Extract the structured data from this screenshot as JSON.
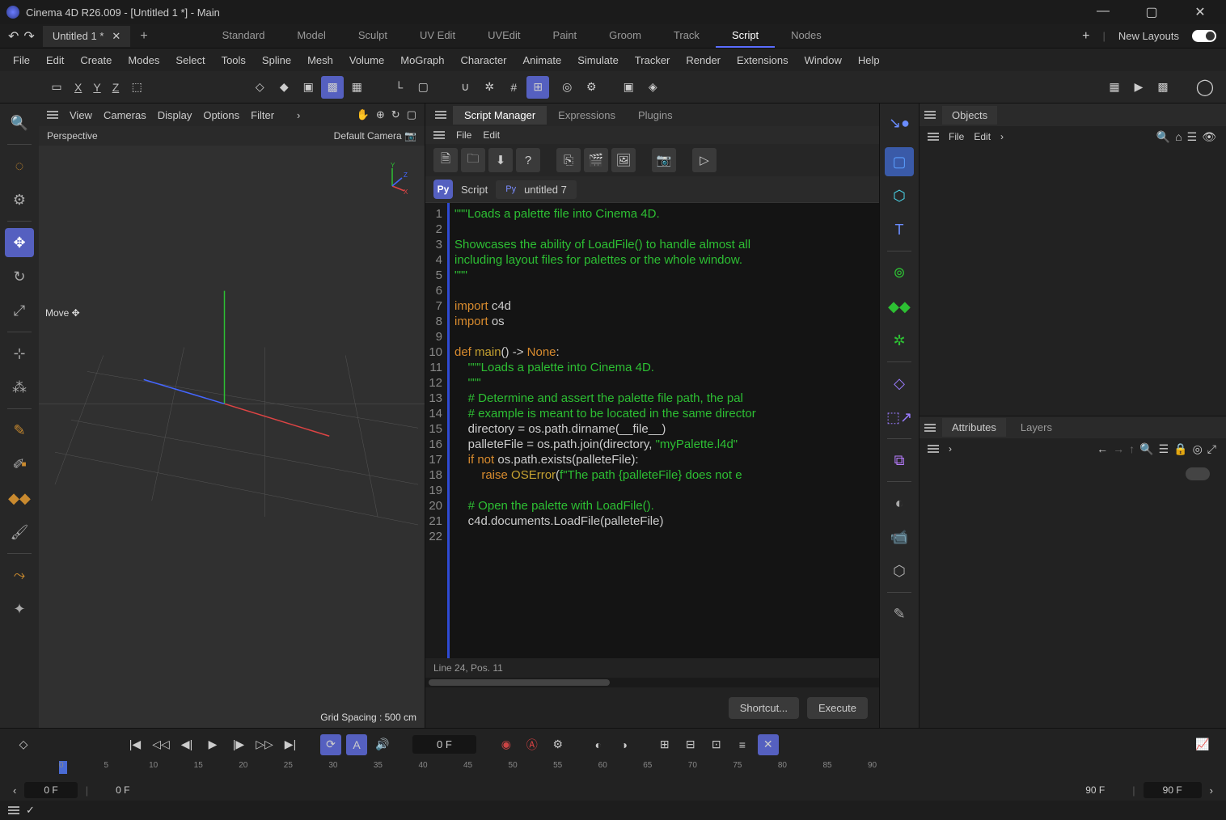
{
  "title": "Cinema 4D R26.009 - [Untitled 1 *] - Main",
  "file_tab": "Untitled 1 *",
  "layouts": [
    "Standard",
    "Model",
    "Sculpt",
    "UV Edit",
    "UVEdit",
    "Paint",
    "Groom",
    "Track",
    "Script",
    "Nodes"
  ],
  "active_layout": 8,
  "new_layouts": "New Layouts",
  "menu": [
    "File",
    "Edit",
    "Create",
    "Modes",
    "Select",
    "Tools",
    "Spline",
    "Mesh",
    "Volume",
    "MoGraph",
    "Character",
    "Animate",
    "Simulate",
    "Tracker",
    "Render",
    "Extensions",
    "Window",
    "Help"
  ],
  "xyz": [
    "X",
    "Y",
    "Z"
  ],
  "viewport": {
    "menu": [
      "View",
      "Cameras",
      "Display",
      "Options",
      "Filter"
    ],
    "label": "Perspective",
    "camera": "Default Camera",
    "mode": "Move",
    "grid": "Grid Spacing : 500 cm"
  },
  "script": {
    "tabs": [
      "Script Manager",
      "Expressions",
      "Plugins"
    ],
    "menu": [
      "File",
      "Edit"
    ],
    "label": "Script",
    "name": "untitled 7",
    "status": "Line 24, Pos. 11",
    "btn_shortcut": "Shortcut...",
    "btn_execute": "Execute",
    "code_lines": [
      [
        [
          "\"\"\"Loads a palette file into Cinema 4D.",
          "c-str"
        ]
      ],
      [],
      [
        [
          "Showcases the ability of LoadFile() to handle almost all",
          "c-str"
        ]
      ],
      [
        [
          "including layout files for palettes or the whole window.",
          "c-str"
        ]
      ],
      [
        [
          "\"\"\"",
          "c-str"
        ]
      ],
      [],
      [
        [
          "import ",
          "c-kw"
        ],
        [
          "c4d",
          "c-id"
        ]
      ],
      [
        [
          "import ",
          "c-kw"
        ],
        [
          "os",
          "c-id"
        ]
      ],
      [],
      [
        [
          "def ",
          "c-kw"
        ],
        [
          "main",
          "c-fn"
        ],
        [
          "() -> ",
          "c-id"
        ],
        [
          "None",
          "c-kw"
        ],
        [
          ":",
          "c-id"
        ]
      ],
      [
        [
          "    ",
          "c-id"
        ],
        [
          "\"\"\"Loads a palette into Cinema 4D.",
          "c-str"
        ]
      ],
      [
        [
          "    ",
          "c-id"
        ],
        [
          "\"\"\"",
          "c-str"
        ]
      ],
      [
        [
          "    ",
          "c-id"
        ],
        [
          "# Determine and assert the palette file path, the pal",
          "c-cm"
        ]
      ],
      [
        [
          "    ",
          "c-id"
        ],
        [
          "# example is meant to be located in the same director",
          "c-cm"
        ]
      ],
      [
        [
          "    directory = os.path.dirname(__file__)",
          "c-id"
        ]
      ],
      [
        [
          "    palleteFile = os.path.join(directory, ",
          "c-id"
        ],
        [
          "\"myPalette.l4d\"",
          "c-str"
        ]
      ],
      [
        [
          "    ",
          "c-id"
        ],
        [
          "if not ",
          "c-kw"
        ],
        [
          "os.path.exists(palleteFile):",
          "c-id"
        ]
      ],
      [
        [
          "        ",
          "c-id"
        ],
        [
          "raise ",
          "c-kw"
        ],
        [
          "OSError",
          "c-fn"
        ],
        [
          "(",
          "c-id"
        ],
        [
          "f\"The path {palleteFile} does not e",
          "c-str"
        ]
      ],
      [],
      [
        [
          "    ",
          "c-id"
        ],
        [
          "# Open the palette with LoadFile().",
          "c-cm"
        ]
      ],
      [
        [
          "    c4d.documents.LoadFile(palleteFile)",
          "c-id"
        ]
      ],
      []
    ]
  },
  "objects": {
    "title": "Objects",
    "menu": [
      "File",
      "Edit"
    ]
  },
  "attr": {
    "tabs": [
      "Attributes",
      "Layers"
    ]
  },
  "timeline": {
    "frame": "0 F",
    "start": "0 F",
    "start2": "0 F",
    "end": "90 F",
    "end2": "90 F",
    "ticks": [
      "0",
      "5",
      "10",
      "15",
      "20",
      "25",
      "30",
      "35",
      "40",
      "45",
      "50",
      "55",
      "60",
      "65",
      "70",
      "75",
      "80",
      "85",
      "90"
    ]
  }
}
